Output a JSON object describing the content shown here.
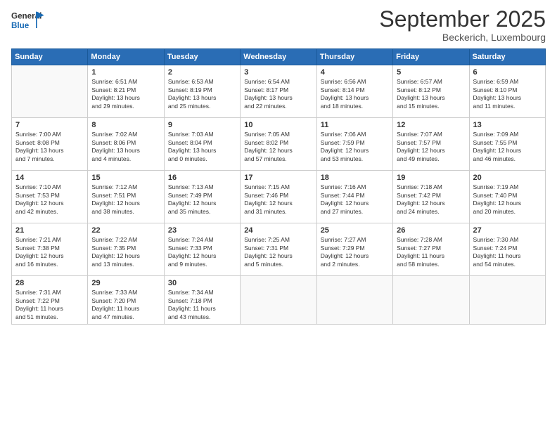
{
  "header": {
    "logo_general": "General",
    "logo_blue": "Blue",
    "month": "September 2025",
    "location": "Beckerich, Luxembourg"
  },
  "days_of_week": [
    "Sunday",
    "Monday",
    "Tuesday",
    "Wednesday",
    "Thursday",
    "Friday",
    "Saturday"
  ],
  "weeks": [
    [
      {
        "day": "",
        "lines": []
      },
      {
        "day": "1",
        "lines": [
          "Sunrise: 6:51 AM",
          "Sunset: 8:21 PM",
          "Daylight: 13 hours",
          "and 29 minutes."
        ]
      },
      {
        "day": "2",
        "lines": [
          "Sunrise: 6:53 AM",
          "Sunset: 8:19 PM",
          "Daylight: 13 hours",
          "and 25 minutes."
        ]
      },
      {
        "day": "3",
        "lines": [
          "Sunrise: 6:54 AM",
          "Sunset: 8:17 PM",
          "Daylight: 13 hours",
          "and 22 minutes."
        ]
      },
      {
        "day": "4",
        "lines": [
          "Sunrise: 6:56 AM",
          "Sunset: 8:14 PM",
          "Daylight: 13 hours",
          "and 18 minutes."
        ]
      },
      {
        "day": "5",
        "lines": [
          "Sunrise: 6:57 AM",
          "Sunset: 8:12 PM",
          "Daylight: 13 hours",
          "and 15 minutes."
        ]
      },
      {
        "day": "6",
        "lines": [
          "Sunrise: 6:59 AM",
          "Sunset: 8:10 PM",
          "Daylight: 13 hours",
          "and 11 minutes."
        ]
      }
    ],
    [
      {
        "day": "7",
        "lines": [
          "Sunrise: 7:00 AM",
          "Sunset: 8:08 PM",
          "Daylight: 13 hours",
          "and 7 minutes."
        ]
      },
      {
        "day": "8",
        "lines": [
          "Sunrise: 7:02 AM",
          "Sunset: 8:06 PM",
          "Daylight: 13 hours",
          "and 4 minutes."
        ]
      },
      {
        "day": "9",
        "lines": [
          "Sunrise: 7:03 AM",
          "Sunset: 8:04 PM",
          "Daylight: 13 hours",
          "and 0 minutes."
        ]
      },
      {
        "day": "10",
        "lines": [
          "Sunrise: 7:05 AM",
          "Sunset: 8:02 PM",
          "Daylight: 12 hours",
          "and 57 minutes."
        ]
      },
      {
        "day": "11",
        "lines": [
          "Sunrise: 7:06 AM",
          "Sunset: 7:59 PM",
          "Daylight: 12 hours",
          "and 53 minutes."
        ]
      },
      {
        "day": "12",
        "lines": [
          "Sunrise: 7:07 AM",
          "Sunset: 7:57 PM",
          "Daylight: 12 hours",
          "and 49 minutes."
        ]
      },
      {
        "day": "13",
        "lines": [
          "Sunrise: 7:09 AM",
          "Sunset: 7:55 PM",
          "Daylight: 12 hours",
          "and 46 minutes."
        ]
      }
    ],
    [
      {
        "day": "14",
        "lines": [
          "Sunrise: 7:10 AM",
          "Sunset: 7:53 PM",
          "Daylight: 12 hours",
          "and 42 minutes."
        ]
      },
      {
        "day": "15",
        "lines": [
          "Sunrise: 7:12 AM",
          "Sunset: 7:51 PM",
          "Daylight: 12 hours",
          "and 38 minutes."
        ]
      },
      {
        "day": "16",
        "lines": [
          "Sunrise: 7:13 AM",
          "Sunset: 7:49 PM",
          "Daylight: 12 hours",
          "and 35 minutes."
        ]
      },
      {
        "day": "17",
        "lines": [
          "Sunrise: 7:15 AM",
          "Sunset: 7:46 PM",
          "Daylight: 12 hours",
          "and 31 minutes."
        ]
      },
      {
        "day": "18",
        "lines": [
          "Sunrise: 7:16 AM",
          "Sunset: 7:44 PM",
          "Daylight: 12 hours",
          "and 27 minutes."
        ]
      },
      {
        "day": "19",
        "lines": [
          "Sunrise: 7:18 AM",
          "Sunset: 7:42 PM",
          "Daylight: 12 hours",
          "and 24 minutes."
        ]
      },
      {
        "day": "20",
        "lines": [
          "Sunrise: 7:19 AM",
          "Sunset: 7:40 PM",
          "Daylight: 12 hours",
          "and 20 minutes."
        ]
      }
    ],
    [
      {
        "day": "21",
        "lines": [
          "Sunrise: 7:21 AM",
          "Sunset: 7:38 PM",
          "Daylight: 12 hours",
          "and 16 minutes."
        ]
      },
      {
        "day": "22",
        "lines": [
          "Sunrise: 7:22 AM",
          "Sunset: 7:35 PM",
          "Daylight: 12 hours",
          "and 13 minutes."
        ]
      },
      {
        "day": "23",
        "lines": [
          "Sunrise: 7:24 AM",
          "Sunset: 7:33 PM",
          "Daylight: 12 hours",
          "and 9 minutes."
        ]
      },
      {
        "day": "24",
        "lines": [
          "Sunrise: 7:25 AM",
          "Sunset: 7:31 PM",
          "Daylight: 12 hours",
          "and 5 minutes."
        ]
      },
      {
        "day": "25",
        "lines": [
          "Sunrise: 7:27 AM",
          "Sunset: 7:29 PM",
          "Daylight: 12 hours",
          "and 2 minutes."
        ]
      },
      {
        "day": "26",
        "lines": [
          "Sunrise: 7:28 AM",
          "Sunset: 7:27 PM",
          "Daylight: 11 hours",
          "and 58 minutes."
        ]
      },
      {
        "day": "27",
        "lines": [
          "Sunrise: 7:30 AM",
          "Sunset: 7:24 PM",
          "Daylight: 11 hours",
          "and 54 minutes."
        ]
      }
    ],
    [
      {
        "day": "28",
        "lines": [
          "Sunrise: 7:31 AM",
          "Sunset: 7:22 PM",
          "Daylight: 11 hours",
          "and 51 minutes."
        ]
      },
      {
        "day": "29",
        "lines": [
          "Sunrise: 7:33 AM",
          "Sunset: 7:20 PM",
          "Daylight: 11 hours",
          "and 47 minutes."
        ]
      },
      {
        "day": "30",
        "lines": [
          "Sunrise: 7:34 AM",
          "Sunset: 7:18 PM",
          "Daylight: 11 hours",
          "and 43 minutes."
        ]
      },
      {
        "day": "",
        "lines": []
      },
      {
        "day": "",
        "lines": []
      },
      {
        "day": "",
        "lines": []
      },
      {
        "day": "",
        "lines": []
      }
    ]
  ]
}
